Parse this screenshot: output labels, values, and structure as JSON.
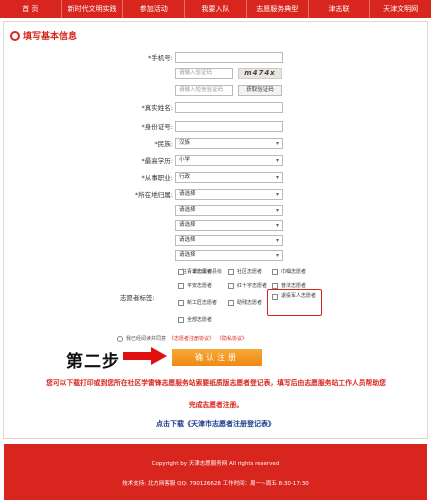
{
  "nav": [
    "首 页",
    "新时代文明实践",
    "参加活动",
    "我要入队",
    "志愿服务典型",
    "津志联",
    "天津文明网"
  ],
  "heading": "填写基本信息",
  "fields": {
    "phone_label": "*手机号:",
    "captcha_placeholder": "请输入验证码",
    "captcha_text": "m474x",
    "sms_placeholder": "请输入短信验证码",
    "sms_button": "获取验证码",
    "name_label": "*真实姓名:",
    "id_label": "*身份证号:",
    "ethnicity_label": "*民族:",
    "ethnicity_value": "汉族",
    "education_label": "*最高学历:",
    "education_value": "小学",
    "occupation_label": "*从事职业:",
    "occupation_value": "行政",
    "region_label": "*所在地归属:",
    "region_selects": [
      "请选择",
      "请选择",
      "请选择",
      "请选择",
      "请选择"
    ]
  },
  "note": "注：请归属到县级",
  "volunteer_label": "志愿者标签:",
  "volunteer_tags": [
    "青年志愿者",
    "社区志愿者",
    "巾帼志愿者",
    "平安志愿者",
    "红十字志愿者",
    "普法志愿者",
    "新工匠志愿者",
    "助残志愿者",
    "退役军人志愿者",
    "全部志愿者"
  ],
  "agree": {
    "text": "我已经阅读并同意",
    "link1": "《志愿者注册协议》",
    "link2": "《隐私协议》"
  },
  "step_label": "第二步",
  "submit_label": "确认注册",
  "info_line1": "您可以下载打印或到您所在社区学雷锋志愿服务站索要纸质版志愿者登记表，填写后由志愿服务站工作人员帮助您",
  "info_line2": "完成志愿者注册。",
  "download_link": "点击下载《天津市志愿者注册登记表》",
  "footer": {
    "copyright": "Copyright by 天津志愿服务网 All rights reserved",
    "support": "技术支持: 北方网客服 QQ: 790126628  工作时间：周一~周五 8:30-17:30"
  }
}
